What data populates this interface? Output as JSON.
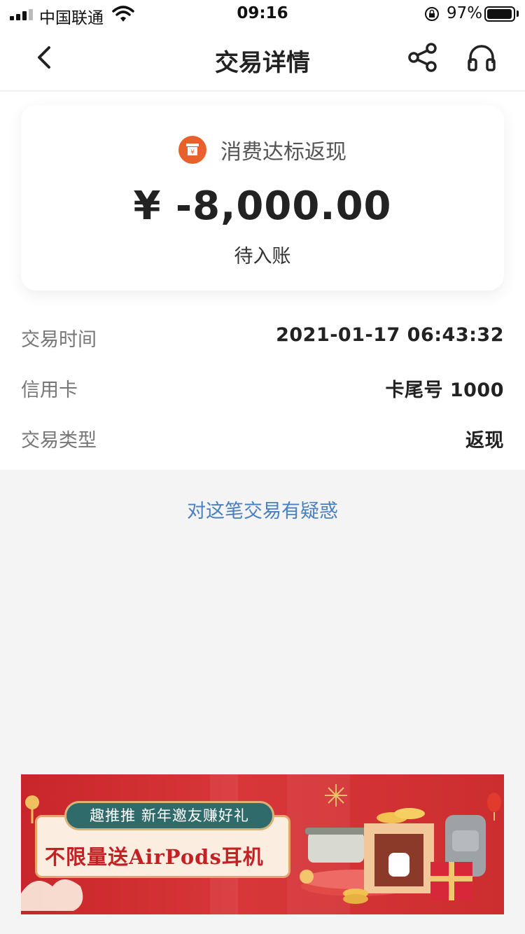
{
  "status_bar": {
    "carrier": "中国联通",
    "time": "09:16",
    "battery": "97%",
    "battery_level": 0.97
  },
  "nav": {
    "title": "交易详情",
    "back_icon": "chevron-left-icon",
    "share_icon": "share-icon",
    "service_icon": "headphones-icon"
  },
  "summary": {
    "merchant": "消费达标返现",
    "merchant_icon": "yen-box-icon",
    "merchant_icon_color": "#e8612c",
    "amount": "¥ -8,000.00",
    "status": "待入账"
  },
  "details": [
    {
      "label": "交易时间",
      "value": "2021-01-17 06:43:32"
    },
    {
      "label": "信用卡",
      "value": "卡尾号 1000"
    },
    {
      "label": "交易类型",
      "value": "返现"
    }
  ],
  "dispute_link": "对这笔交易有疑惑",
  "banner": {
    "tag": "趣推推  新年邀友赚好礼",
    "headline": "不限量送AirPods耳机"
  },
  "colors": {
    "link": "#4a7fc1",
    "banner_red": "#d8373a"
  }
}
